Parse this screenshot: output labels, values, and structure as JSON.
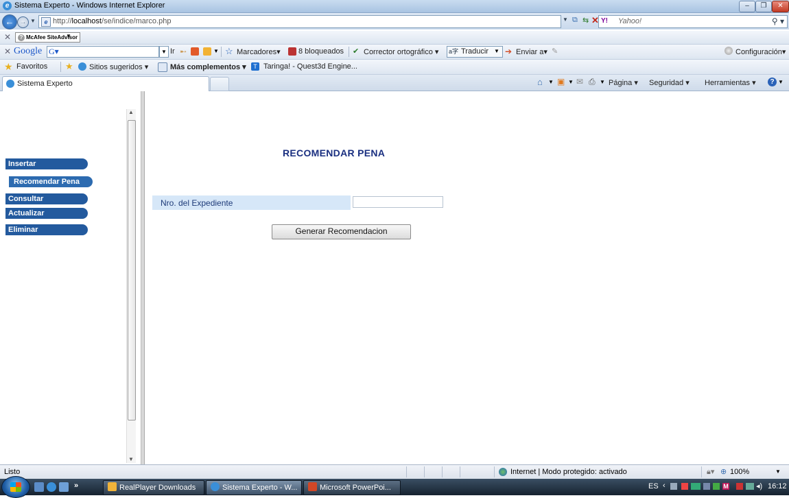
{
  "window": {
    "title": "Sistema Experto - Windows Internet Explorer",
    "controls": [
      "minimize",
      "restore",
      "close"
    ]
  },
  "address_bar": {
    "url_prefix": "http://",
    "url_host": "localhost",
    "url_path": "/se/indice/marco.php",
    "search_provider": "Y! Yahoo!",
    "search_placeholder": "Yahoo!"
  },
  "mcafee_toolbar": {
    "badge": "McAfee SiteAdvisor"
  },
  "google_toolbar": {
    "logo": "Google",
    "ir": "Ir",
    "marcadores": "Marcadores",
    "bloqueados": "8 bloqueados",
    "corrector": "Corrector ortográfico",
    "traducir": "Traducir",
    "enviar": "Enviar a",
    "configuracion": "Configuración"
  },
  "favorites_bar": {
    "favoritos": "Favoritos",
    "items": [
      "Sitios sugeridos",
      "Más complementos",
      "Taringa! - Quest3d Engine..."
    ]
  },
  "tabs": {
    "active_tab": "Sistema Experto"
  },
  "command_bar": {
    "pagina": "Página",
    "seguridad": "Seguridad",
    "herramientas": "Herramientas"
  },
  "sidebar_menu": {
    "items": [
      {
        "label": "Insertar"
      },
      {
        "label": "Recomendar Pena"
      },
      {
        "label": "Consultar"
      },
      {
        "label": "Actualizar"
      },
      {
        "label": "Eliminar"
      }
    ]
  },
  "main": {
    "title": "RECOMENDAR PENA",
    "field_label": "Nro. del Expediente",
    "field_value": "",
    "button_label": "Generar Recomendacion"
  },
  "status_bar": {
    "status": "Listo",
    "zone": "Internet | Modo protegido: activado",
    "zoom": "100%"
  },
  "taskbar": {
    "tasks": [
      {
        "label": "RealPlayer Downloads"
      },
      {
        "label": "Sistema Experto - W..."
      },
      {
        "label": "Microsoft PowerPoi..."
      }
    ],
    "language": "ES",
    "clock": "16:12"
  },
  "colors": {
    "menu_blue": "#235a9e",
    "title_navy": "#1a2f80",
    "field_bg": "#d6e7f8"
  }
}
